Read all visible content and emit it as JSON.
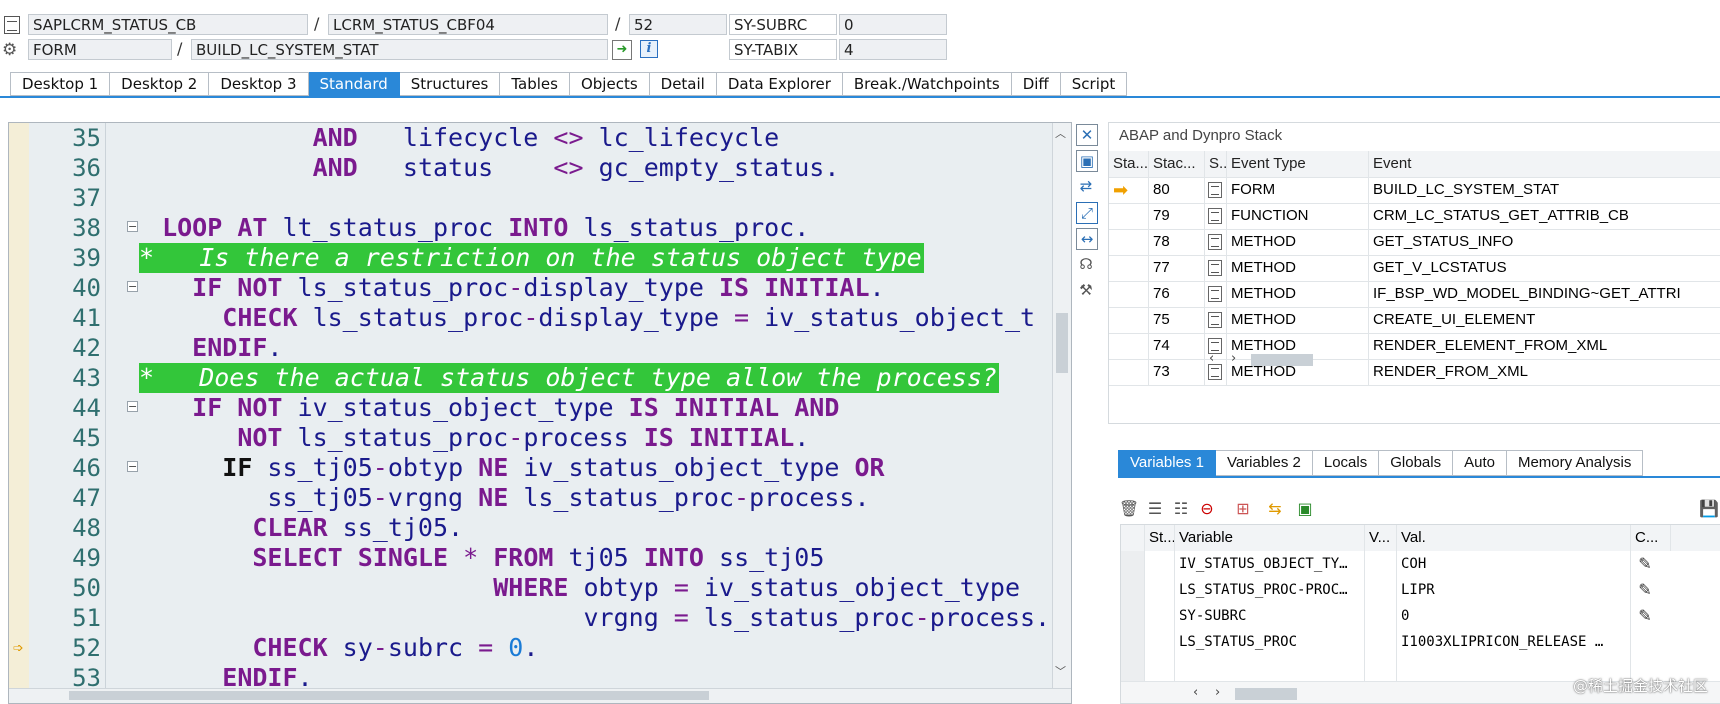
{
  "header": {
    "program": "SAPLCRM_STATUS_CB",
    "include": "LCRM_STATUS_CBF04",
    "line": "52",
    "sy_subrc_label": "SY-SUBRC",
    "sy_subrc_value": "0",
    "event_type": "FORM",
    "event_name": "BUILD_LC_SYSTEM_STAT",
    "sy_tabix_label": "SY-TABIX",
    "sy_tabix_value": "4",
    "sep1": "/",
    "sep2": "/",
    "sep3": "/"
  },
  "tabs": [
    "Desktop 1",
    "Desktop 2",
    "Desktop 3",
    "Standard",
    "Structures",
    "Tables",
    "Objects",
    "Detail",
    "Data Explorer",
    "Break./Watchpoints",
    "Diff",
    "Script"
  ],
  "active_tab": "Standard",
  "code": {
    "line_numbers": [
      "35",
      "36",
      "37",
      "38",
      "39",
      "40",
      "41",
      "42",
      "43",
      "44",
      "45",
      "46",
      "47",
      "48",
      "49",
      "50",
      "51",
      "52",
      "53"
    ],
    "current_line": "52",
    "comment_39": "*   Is there a restriction on the status object type",
    "comment_43": "*   Does the actual status object type allow the process?"
  },
  "stack": {
    "title": "ABAP and Dynpro Stack",
    "columns": [
      "Sta...",
      "Stac...",
      "S..",
      "Event Type",
      "Event"
    ],
    "rows": [
      {
        "level": "80",
        "type": "FORM",
        "event": "BUILD_LC_SYSTEM_STAT",
        "current": true
      },
      {
        "level": "79",
        "type": "FUNCTION",
        "event": "CRM_LC_STATUS_GET_ATTRIB_CB"
      },
      {
        "level": "78",
        "type": "METHOD",
        "event": "GET_STATUS_INFO"
      },
      {
        "level": "77",
        "type": "METHOD",
        "event": "GET_V_LCSTATUS"
      },
      {
        "level": "76",
        "type": "METHOD",
        "event": "IF_BSP_WD_MODEL_BINDING~GET_ATTRI"
      },
      {
        "level": "75",
        "type": "METHOD",
        "event": "CREATE_UI_ELEMENT"
      },
      {
        "level": "74",
        "type": "METHOD",
        "event": "RENDER_ELEMENT_FROM_XML"
      },
      {
        "level": "73",
        "type": "METHOD",
        "event": "RENDER_FROM_XML"
      }
    ]
  },
  "var_tabs": [
    "Variables 1",
    "Variables 2",
    "Locals",
    "Globals",
    "Auto",
    "Memory Analysis"
  ],
  "variables": {
    "columns": [
      "St...",
      "Variable",
      "V...",
      "Val.",
      "C..."
    ],
    "rows": [
      {
        "name": "IV_STATUS_OBJECT_TY…",
        "value": "COH"
      },
      {
        "name": "LS_STATUS_PROC-PROC…",
        "value": "LIPR"
      },
      {
        "name": "SY-SUBRC",
        "value": "0"
      },
      {
        "name": "LS_STATUS_PROC",
        "value": "I1003XLIPRICON_RELEASE  …"
      }
    ]
  },
  "watermark": "@稀土掘金技术社区",
  "icons": [
    "program-icon",
    "settings-icon",
    "jump-icon",
    "info-icon",
    "trash-icon",
    "pencil-icon",
    "arrow-icon"
  ],
  "colors": {
    "accent": "#2a88d8",
    "comment_bg": "#33c63a",
    "keyword": "#7a1a8e",
    "identifier": "#1a1a8c",
    "number": "#1a7bd6"
  }
}
